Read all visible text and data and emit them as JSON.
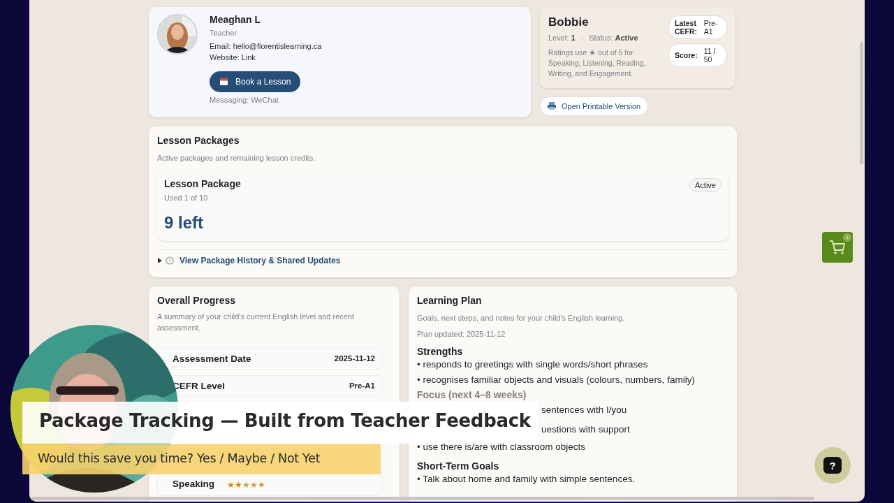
{
  "teacher": {
    "name": "Meaghan L",
    "role": "Teacher",
    "email_label": "Email:",
    "email": "hello@florentislearning.ca",
    "website_label": "Website:",
    "website": "Link",
    "book_button": "Book a Lesson",
    "messaging": "Messaging: WeChat"
  },
  "student": {
    "name": "Bobbie",
    "level_label": "Level:",
    "level": "1",
    "separator": "·",
    "status_label": "Status:",
    "status": "Active",
    "ratings_note": "Ratings use ★ out of 5 for Speaking, Listening, Reading, Writing, and Engagement.",
    "badges": [
      {
        "label": "Latest CEFR:",
        "value": "Pre-A1"
      },
      {
        "label": "Score:",
        "value": "11 / 50"
      }
    ],
    "print_button": "Open Printable Version"
  },
  "packages": {
    "title": "Lesson Packages",
    "subtitle": "Active packages and remaining lesson credits.",
    "items": [
      {
        "name": "Lesson Package",
        "used": "Used 1 of 10",
        "status": "Active",
        "remaining": "9 left"
      }
    ],
    "history_link": "View Package History & Shared Updates",
    "expanded": false
  },
  "progress": {
    "title": "Overall Progress",
    "subtitle": "A summary of your child's current English level and recent assessment.",
    "rows": [
      {
        "kind": "value",
        "label": "Assessment Date",
        "value": "2025-11-12"
      },
      {
        "kind": "value",
        "label": "CEFR Level",
        "value": "Pre-A1"
      },
      {
        "kind": "stars",
        "label": "Speaking",
        "stars": 2
      }
    ]
  },
  "plan": {
    "title": "Learning Plan",
    "subtitle": "Goals, next steps, and notes for your child's English learning.",
    "updated": "Plan updated: 2025-11-12",
    "sections": [
      {
        "title": "Strengths",
        "faded": false,
        "items": [
          {
            "text": "• responds to greetings with single words/short phrases",
            "covered": false
          },
          {
            "text": "• recognises familiar objects and visuals (colours, numbers, family)",
            "covered": false
          }
        ]
      },
      {
        "title": "Focus (next 4–8 weeks)",
        "faded": true,
        "items": [
          {
            "text": "sentences with I/you",
            "covered": true
          },
          {
            "text": "uestions with support",
            "covered": true
          },
          {
            "text": "• use there is/are with classroom objects",
            "covered": false
          }
        ]
      },
      {
        "title": "Short-Term Goals",
        "faded": false,
        "items": [
          {
            "text": "• Talk about home and family with simple sentences.",
            "covered": false
          }
        ]
      }
    ]
  },
  "cart": {
    "count": "1"
  },
  "help": {
    "label": "?"
  },
  "caption": {
    "title": "Package Tracking — Built from Teacher Feedback",
    "question": "Would this save you time? Yes / Maybe / Not Yet"
  }
}
